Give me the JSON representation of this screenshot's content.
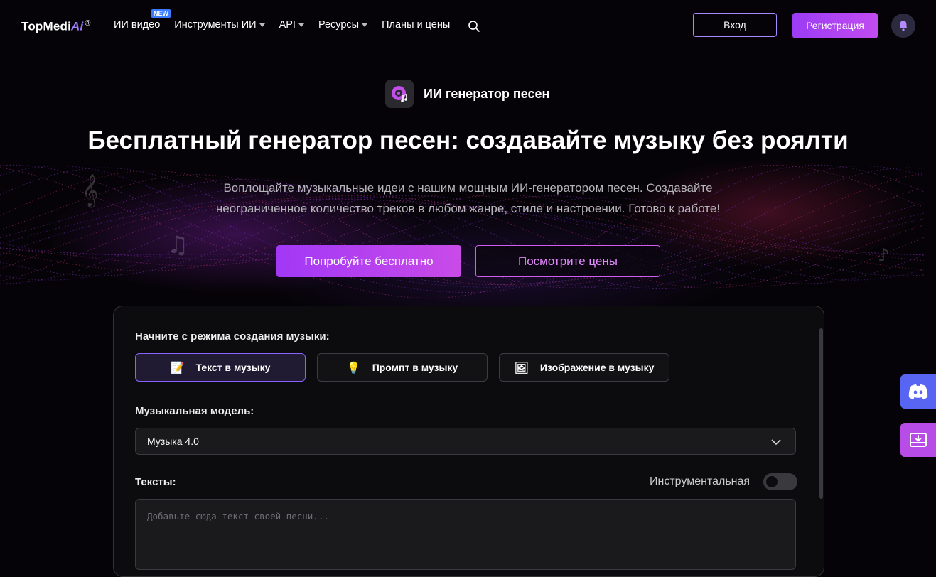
{
  "colors": {
    "accent": "#a238f6",
    "outline": "#a68aff",
    "discord": "#5865f2",
    "download": "#b84ce6"
  },
  "header": {
    "logo_text": "TopMedi",
    "logo_ai": "Ai",
    "logo_mark": "®",
    "nav": [
      {
        "label": "ИИ видео",
        "badge": "NEW"
      },
      {
        "label": "Инструменты ИИ"
      },
      {
        "label": "API"
      },
      {
        "label": "Ресурсы"
      },
      {
        "label": "Планы и цены"
      }
    ],
    "search_icon": "search-icon",
    "login_label": "Вход",
    "signup_label": "Регистрация",
    "bell_icon": "bell-icon"
  },
  "hero": {
    "product_name": "ИИ генератор песен",
    "product_icon": "music-disc-icon",
    "title": "Бесплатный генератор песен: создавайте музыку без роялти",
    "subtitle_line1": "Воплощайте музыкальные идеи с нашим мощным ИИ-генератором песен. Создавайте",
    "subtitle_line2": "неограниченное количество треков в любом жанре, стиле и настроении. Готово к работе!",
    "try_label": "Попробуйте бесплатно",
    "pricing_label": "Посмотрите цены"
  },
  "panel": {
    "mode_label": "Начните с режима создания музыки:",
    "modes": [
      {
        "label": "Текст в музыку",
        "icon": "memo-icon",
        "active": true
      },
      {
        "label": "Промпт в музыку",
        "icon": "lightbulb-icon",
        "active": false
      },
      {
        "label": "Изображение в музыку",
        "icon": "picture-icon",
        "active": false
      }
    ],
    "model_label": "Музыкальная модель:",
    "model_value": "Музыка 4.0",
    "lyrics_label": "Тексты:",
    "instrumental_label": "Инструментальная",
    "instrumental_on": false,
    "lyrics_placeholder": "Добавьте сюда текст своей песни..."
  },
  "floating": {
    "discord_icon": "discord-icon",
    "download_icon": "download-icon"
  }
}
